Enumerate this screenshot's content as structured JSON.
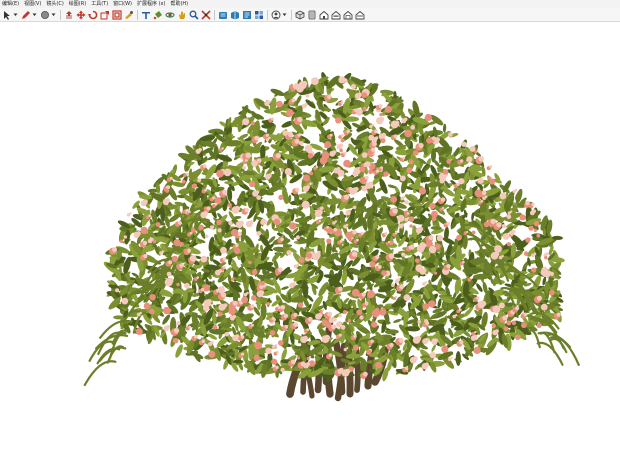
{
  "menubar": {
    "items": [
      "编辑(E)",
      "视图(V)",
      "镜头(C)",
      "绘图(R)",
      "工具(T)",
      "窗口(W)",
      "扩展程序 (x)",
      "帮助(H)"
    ]
  },
  "toolbar": {
    "tools": [
      {
        "icon": "select-arrow-icon",
        "color": "#333333",
        "dropdown": true
      },
      {
        "icon": "pencil-icon",
        "color": "#c0392b",
        "dropdown": true
      },
      {
        "icon": "circle-shape-icon",
        "color": "#555555",
        "dropdown": true
      },
      {
        "icon": "push-pull-icon",
        "color": "#b03a2e"
      },
      {
        "icon": "move-icon",
        "color": "#c0392b"
      },
      {
        "icon": "rotate-icon",
        "color": "#c0392b"
      },
      {
        "icon": "scale-icon",
        "color": "#c0392b"
      },
      {
        "icon": "offset-icon",
        "color": "#c0392b"
      },
      {
        "icon": "tape-measure-icon",
        "color": "#d4a017"
      },
      {
        "icon": "text-icon",
        "color": "#2c5aa0"
      },
      {
        "icon": "paint-bucket-icon",
        "color": "#5a8f29"
      },
      {
        "icon": "orbit-icon",
        "color": "#2e8b57"
      },
      {
        "icon": "pan-icon",
        "color": "#d4a017"
      },
      {
        "icon": "zoom-icon",
        "color": "#2c5aa0"
      },
      {
        "icon": "zoom-extents-icon",
        "color": "#c0392b"
      },
      {
        "icon": "warehouse-icon",
        "color": "#2c7bb6"
      },
      {
        "icon": "extension-warehouse-icon",
        "color": "#2c7bb6"
      },
      {
        "icon": "send-to-layout-icon",
        "color": "#2c7bb6"
      },
      {
        "icon": "extension-manager-icon",
        "color": "#2c5aa0"
      },
      {
        "icon": "user-account-icon",
        "color": "#444444",
        "dropdown": true
      },
      {
        "icon": "camera-iso-icon",
        "color": "#444444"
      },
      {
        "icon": "camera-top-icon",
        "color": "#444444"
      },
      {
        "icon": "camera-front-icon",
        "color": "#444444"
      },
      {
        "icon": "camera-right-icon",
        "color": "#444444"
      },
      {
        "icon": "camera-back-icon",
        "color": "#444444"
      },
      {
        "icon": "camera-left-icon",
        "color": "#444444"
      }
    ]
  },
  "scene": {
    "object": "flowering-shrub-model",
    "foliage_color": "#6b7f2a",
    "foliage_dark": "#4b5e1c",
    "foliage_light": "#8aa03a",
    "flower_color": "#e8907c",
    "flower_light": "#f6c9bd",
    "trunk_color": "#5b4630",
    "background": "#ffffff"
  }
}
